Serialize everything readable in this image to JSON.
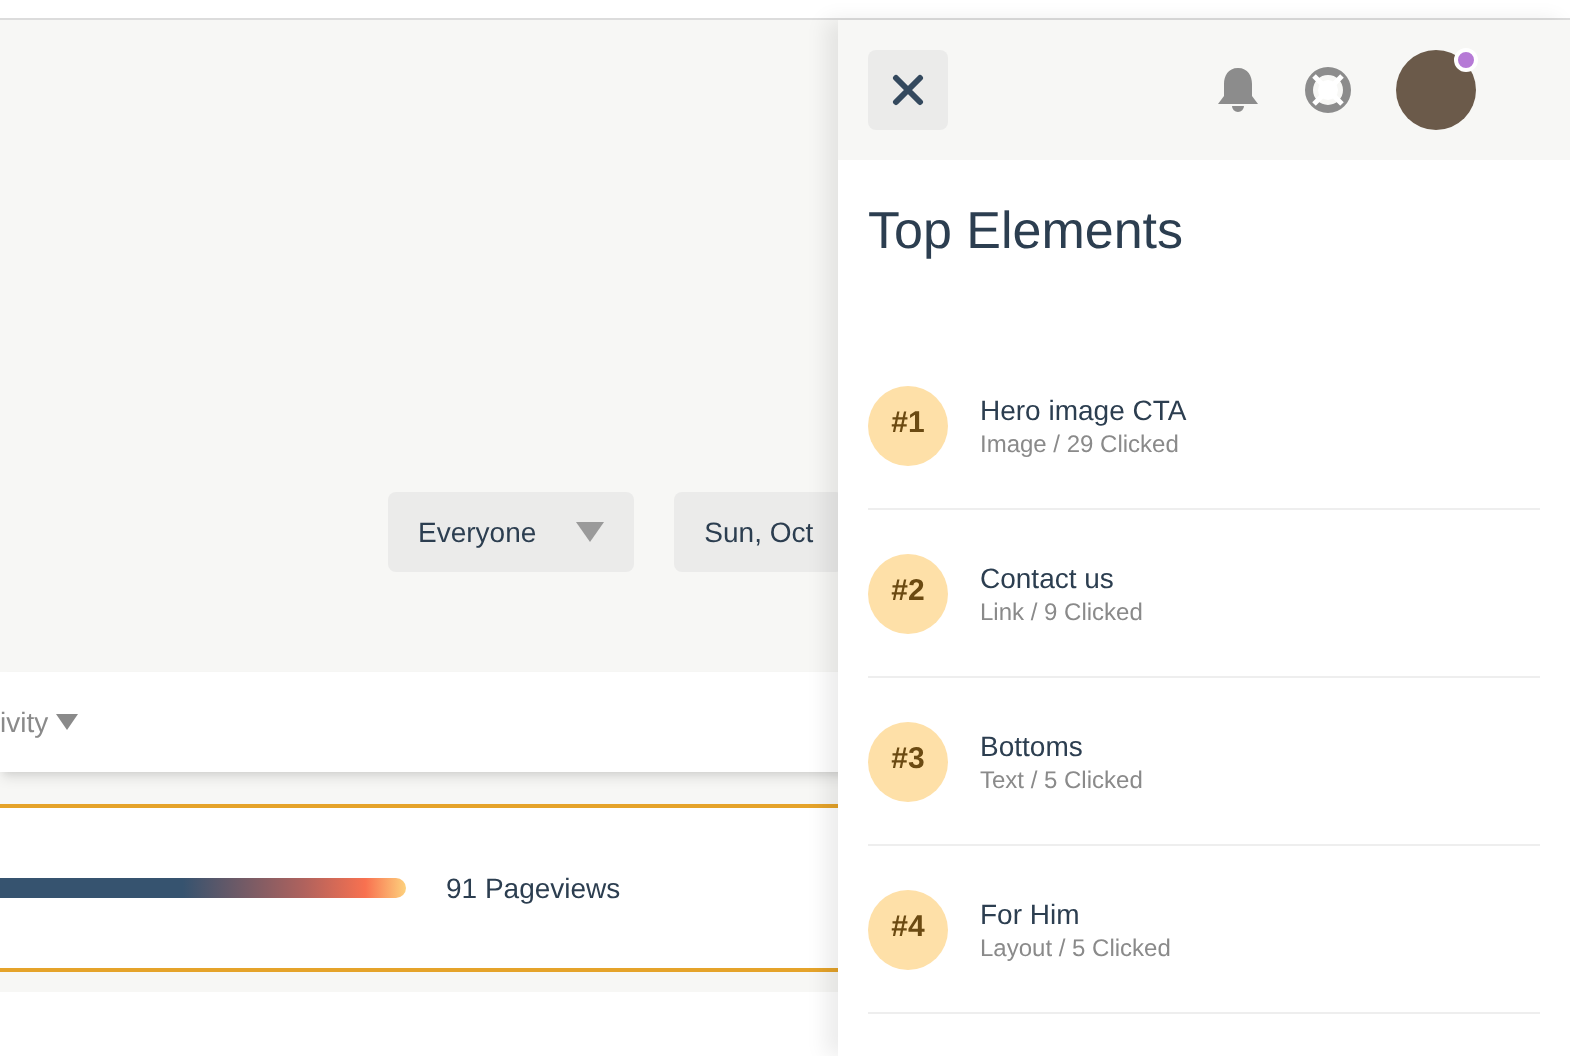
{
  "filters": [
    {
      "label": "Everyone",
      "has_caret": true
    },
    {
      "label": "Sun, Oct",
      "has_caret": false
    }
  ],
  "activity_selector": {
    "label": "ivity"
  },
  "pageview_row": {
    "reading": "91 Pageviews"
  },
  "panel": {
    "title": "Top Elements",
    "notification_dot": true,
    "items": [
      {
        "rank": "#1",
        "name": "Hero image CTA",
        "detail": "Image / 29 Clicked"
      },
      {
        "rank": "#2",
        "name": "Contact us",
        "detail": "Link / 9 Clicked"
      },
      {
        "rank": "#3",
        "name": "Bottoms",
        "detail": "Text / 5 Clicked"
      },
      {
        "rank": "#4",
        "name": "For Him",
        "detail": "Layout / 5 Clicked"
      }
    ]
  }
}
